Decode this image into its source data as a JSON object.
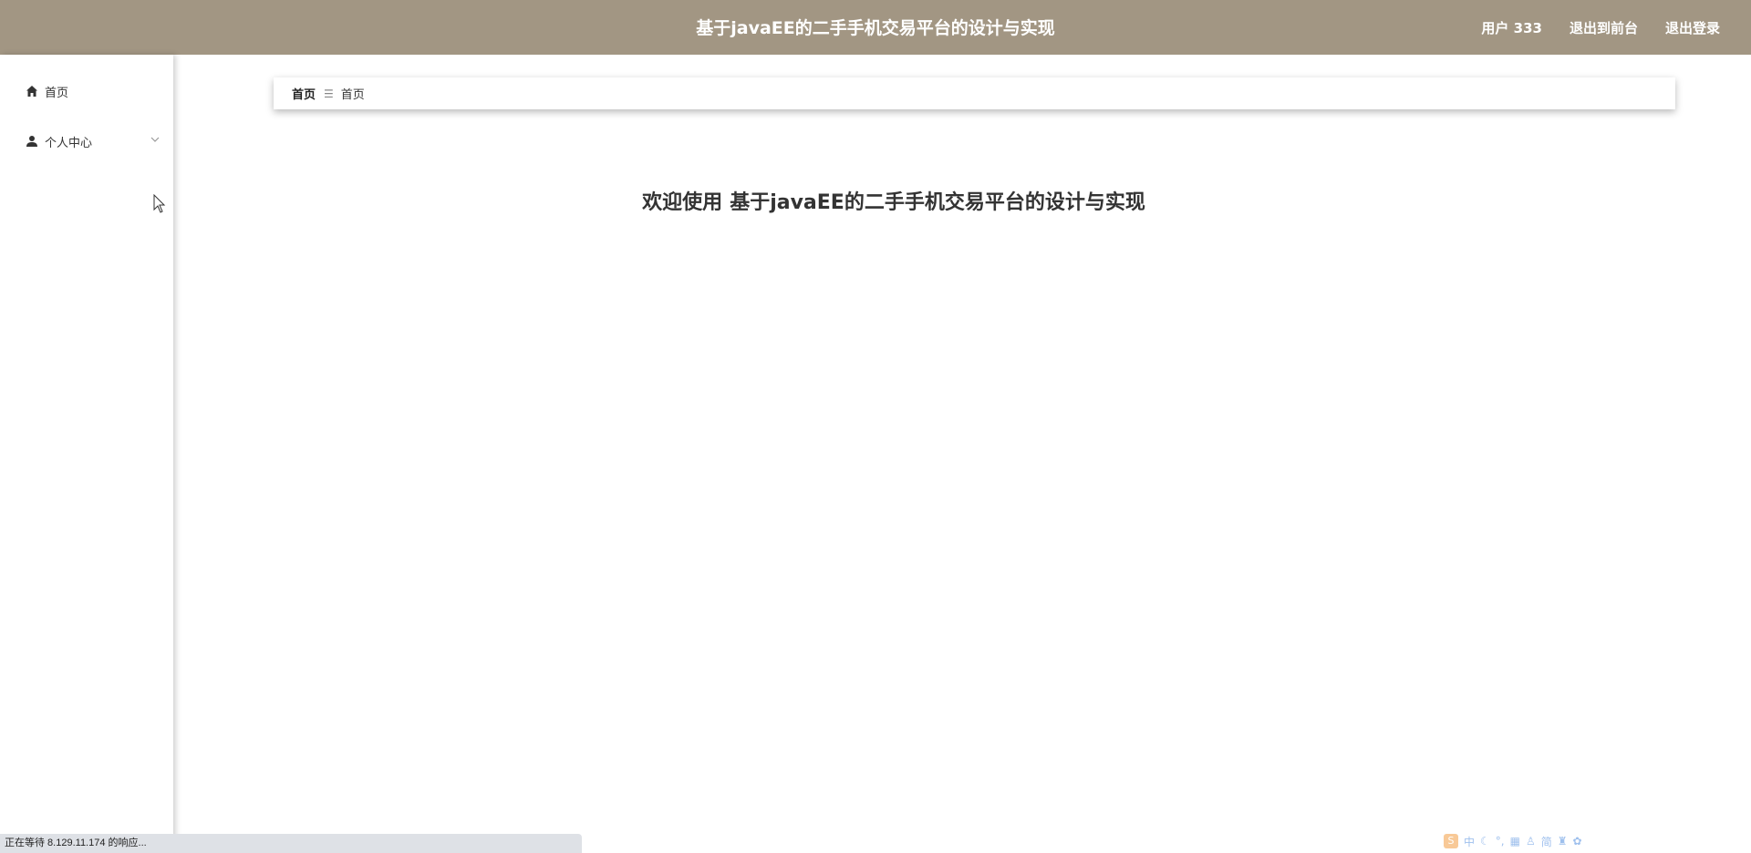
{
  "header": {
    "title": "基于javaEE的二手手机交易平台的设计与实现",
    "user_label": "用户 333",
    "front_label": "退出到前台",
    "logout_label": "退出登录"
  },
  "sidebar": {
    "items": [
      {
        "label": "首页",
        "icon": "home-icon"
      },
      {
        "label": "个人中心",
        "icon": "user-icon",
        "expandable": true
      }
    ]
  },
  "breadcrumb": {
    "items": [
      "首页",
      "首页"
    ],
    "separator": "☰"
  },
  "main": {
    "welcome_prefix": "欢迎使用",
    "welcome_title": "基于javaEE的二手手机交易平台的设计与实现"
  },
  "status_bar": {
    "text": "正在等待 8.129.11.174 的响应..."
  },
  "ime_toolbar": {
    "items": [
      "中",
      "简"
    ]
  },
  "colors": {
    "header_bg": "#a29683",
    "header_text": "#ffffff"
  }
}
